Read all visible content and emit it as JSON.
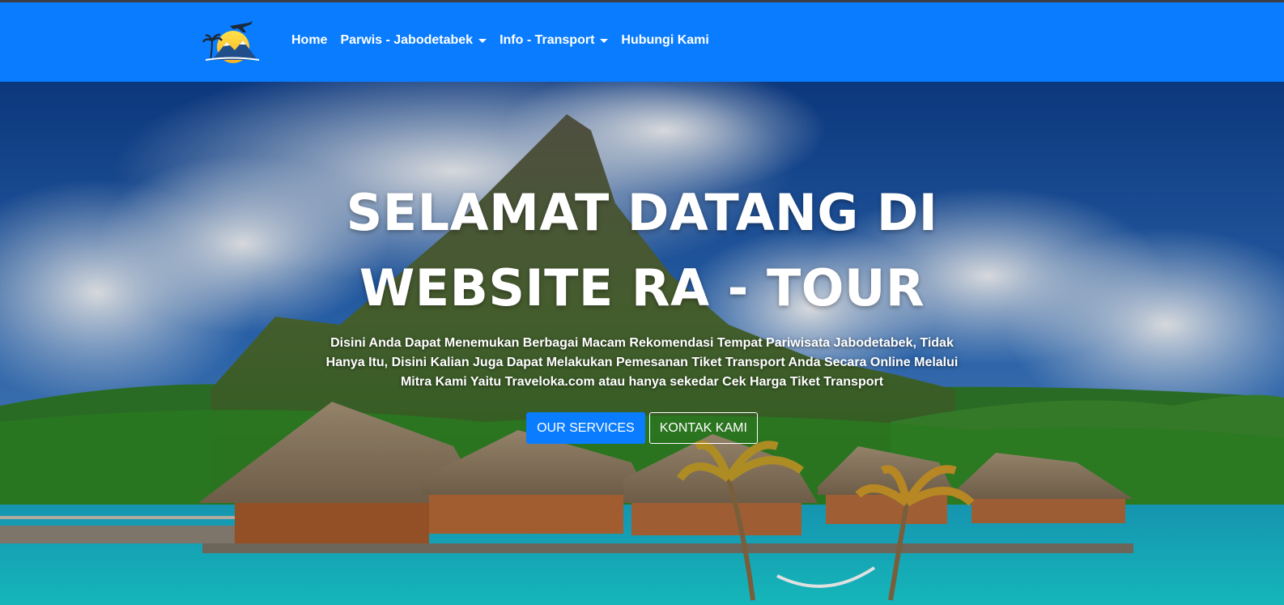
{
  "colors": {
    "navbar": "#0a7cff",
    "accent": "#0a7cff",
    "hero_text": "#ffffff"
  },
  "navbar": {
    "logo_icon": "airplane-palm-mountain-sunset-logo",
    "items": [
      {
        "label": "Home",
        "dropdown": false
      },
      {
        "label": "Parwis - Jabodetabek",
        "dropdown": true
      },
      {
        "label": "Info - Transport",
        "dropdown": true
      },
      {
        "label": "Hubungi Kami",
        "dropdown": false
      }
    ]
  },
  "hero": {
    "title_line1": "SELAMAT DATANG DI",
    "title_line2": "WEBSITE RA - TOUR",
    "description": "Disini Anda Dapat Menemukan Berbagai Macam Rekomendasi Tempat Pariwisata Jabodetabek, Tidak Hanya Itu, Disini Kalian Juga Dapat Melakukan Pemesanan Tiket Transport Anda Secara Online Melalui Mitra Kami Yaitu Traveloka.com atau hanya sekedar Cek Harga Tiket Transport",
    "primary_button": "OUR SERVICES",
    "secondary_button": "KONTAK KAMI",
    "background_image": "tropical-island-overwater-bungalows-photo"
  }
}
